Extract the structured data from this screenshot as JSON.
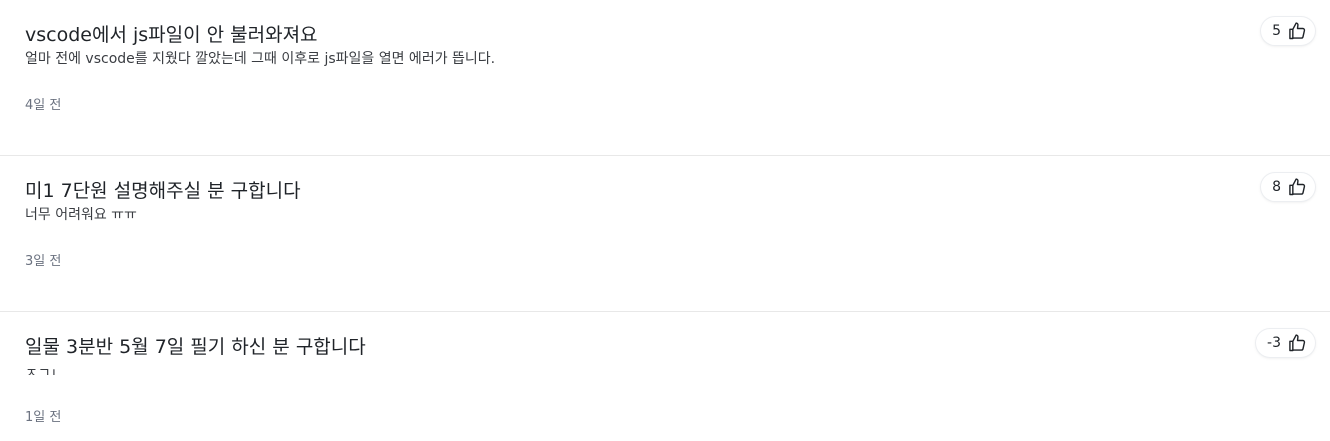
{
  "posts": [
    {
      "title": "vscode에서 js파일이 안 불러와져요",
      "excerpt": "얼마 전에 vscode를 지웠다 깔았는데 그때 이후로 js파일을 열면 에러가 뜹니다.",
      "date": "4일 전",
      "likes": "5",
      "like_icon": "thumbs-up-icon"
    },
    {
      "title": "미1 7단원 설명해주실 분 구합니다",
      "excerpt": "너무 어려워요 ㅠㅠ",
      "date": "3일 전",
      "likes": "8",
      "like_icon": "thumbs-up-icon"
    },
    {
      "title": "일물 3분반 5월 7일 필기 하신 분 구합니다",
      "excerpt": "ㅈㄱㄴ",
      "date": "1일 전",
      "likes": "-3",
      "like_icon": "thumbs-up-icon"
    }
  ]
}
